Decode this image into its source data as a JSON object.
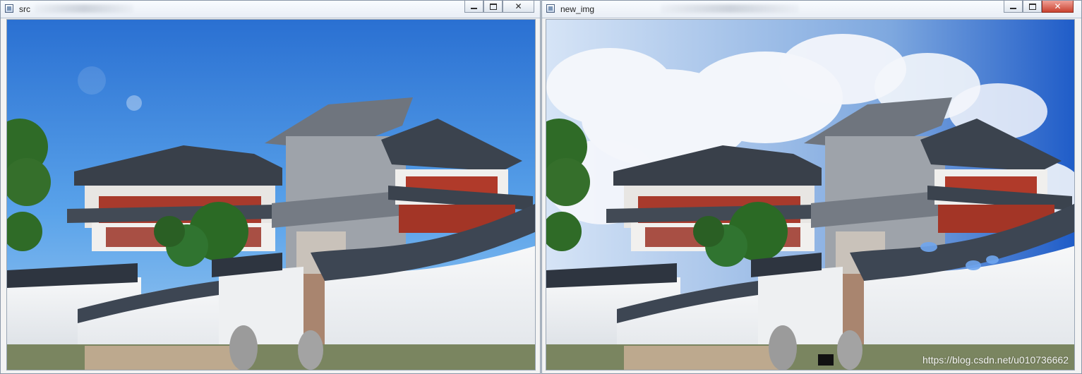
{
  "windows": [
    {
      "id": "src",
      "title": "src",
      "controls": {
        "minimize": "minimize",
        "maximize": "maximize",
        "close": "close"
      }
    },
    {
      "id": "new_img",
      "title": "new_img",
      "controls": {
        "minimize": "minimize",
        "maximize": "maximize",
        "close": "close"
      },
      "watermark": "https://blog.csdn.net/u010736662"
    }
  ],
  "colors": {
    "sky_blue": "#2f78d6",
    "cloud": "#f3f6fb",
    "wall_white": "#f4f6f8",
    "roof_gray": "#3d4653",
    "tree_green": "#2f6b27",
    "pagoda_red": "#a83a2c"
  },
  "icons": {
    "app": "window-app-icon",
    "minimize": "minimize-icon",
    "maximize": "maximize-icon",
    "close": "close-icon"
  }
}
